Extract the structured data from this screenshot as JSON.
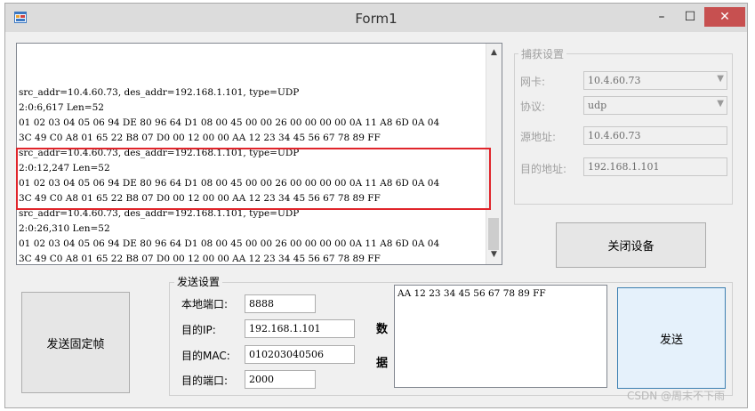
{
  "window": {
    "title": "Form1",
    "minimize_glyph": "–",
    "maximize_glyph": "☐",
    "close_glyph": "✕"
  },
  "log": {
    "lines": [
      "src_addr=10.4.60.73, des_addr=192.168.1.101, type=UDP",
      "2:0:6,617 Len=52",
      "01 02 03 04 05 06 94 DE 80 96 64 D1 08 00 45 00 00 26 00 00 00 00 0A 11 A8 6D 0A 04",
      "3C 49 C0 A8 01 65 22 B8 07 D0 00 12 00 00 AA 12 23 34 45 56 67 78 89 FF",
      "src_addr=10.4.60.73, des_addr=192.168.1.101, type=UDP",
      "2:0:12,247 Len=52",
      "01 02 03 04 05 06 94 DE 80 96 64 D1 08 00 45 00 00 26 00 00 00 00 0A 11 A8 6D 0A 04",
      "3C 49 C0 A8 01 65 22 B8 07 D0 00 12 00 00 AA 12 23 34 45 56 67 78 89 FF",
      "src_addr=10.4.60.73, des_addr=192.168.1.101, type=UDP",
      "2:0:26,310 Len=52",
      "01 02 03 04 05 06 94 DE 80 96 64 D1 08 00 45 00 00 26 00 00 00 00 0A 11 A8 6D 0A 04",
      "3C 49 C0 A8 01 65 22 B8 07 D0 00 12 00 00 AA 12 23 34 45 56 67 78 89 FF"
    ]
  },
  "capture": {
    "title": "捕获设置",
    "nic_label": "网卡:",
    "nic_value": "10.4.60.73",
    "protocol_label": "协议:",
    "protocol_value": "udp",
    "src_label": "源地址:",
    "src_value": "10.4.60.73",
    "dst_label": "目的地址:",
    "dst_value": "192.168.1.101"
  },
  "close_device_label": "关闭设备",
  "send_fixed_label": "发送固定帧",
  "send": {
    "title": "发送设置",
    "local_port_label": "本地端口:",
    "local_port_value": "8888",
    "dst_ip_label": "目的IP:",
    "dst_ip_value": "192.168.1.101",
    "dst_mac_label": "目的MAC:",
    "dst_mac_value": "010203040506",
    "dst_port_label": "目的端口:",
    "dst_port_value": "2000",
    "data_label_1": "数",
    "data_label_2": "据",
    "data_value": "AA 12 23 34 45 56 67 78 89 FF",
    "send_button_label": "发送"
  },
  "watermark": "CSDN @周末不下雨",
  "colors": {
    "highlight_border": "#e0252b",
    "close_button": "#c75050",
    "window_background": "#f0f0f0"
  },
  "icons": {
    "app": "app-icon",
    "scroll_up": "chevron-up-icon",
    "scroll_down": "chevron-down-icon",
    "dropdown": "chevron-down-icon"
  }
}
